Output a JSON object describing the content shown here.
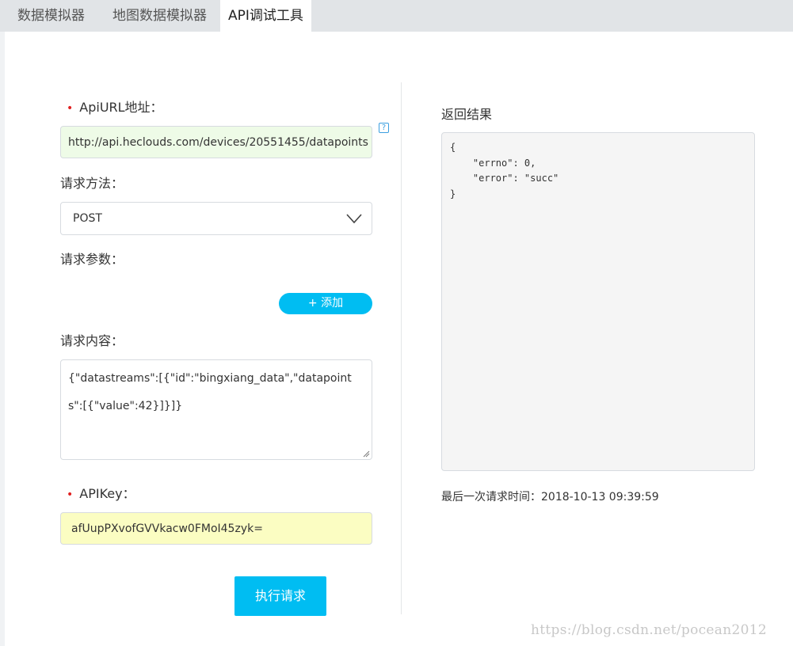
{
  "tabs": [
    {
      "label": "数据模拟器",
      "active": false
    },
    {
      "label": "地图数据模拟器",
      "active": false
    },
    {
      "label": "API调试工具",
      "active": true
    }
  ],
  "form": {
    "required_mark": "•",
    "url_label": "ApiURL地址：",
    "url_value": "http://api.heclouds.com/devices/20551455/datapoints",
    "help_icon": "?",
    "method_label": "请求方法：",
    "method_value": "POST",
    "params_label": "请求参数：",
    "add_button": "+ 添加",
    "body_label": "请求内容：",
    "body_value": "{\"datastreams\":[{\"id\":\"bingxiang_data\",\"datapoints\":[{\"value\":42}]}]}",
    "apikey_label": "APIKey：",
    "apikey_value": "afUupPXvofGVVkacw0FMoI45zyk=",
    "execute_button": "执行请求"
  },
  "result": {
    "title": "返回结果",
    "content": "{\n    \"errno\": 0,\n    \"error\": \"succ\"\n}",
    "last_request_label": "最后一次请求时间：",
    "last_request_time": "2018-10-13 09:39:59"
  },
  "watermark": "https://blog.csdn.net/pocean2012",
  "colors": {
    "accent": "#00bdf2",
    "url_bg": "#eefbe7",
    "apikey_bg": "#fbfdc2",
    "required": "#e02020"
  }
}
